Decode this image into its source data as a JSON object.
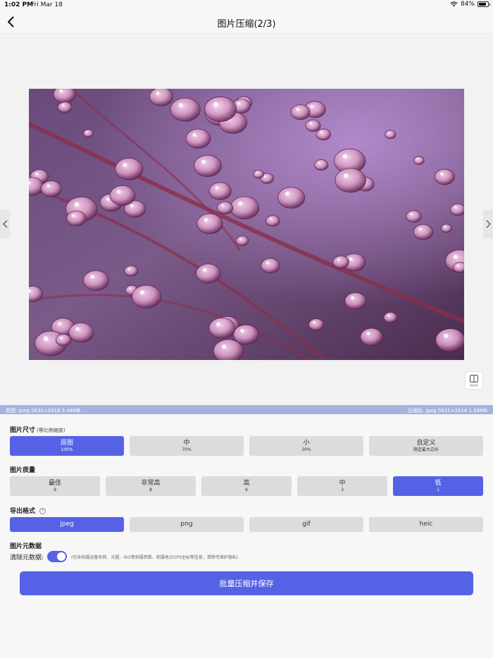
{
  "status_bar": {
    "time": "1:02 PM",
    "date": "Fri Mar 18",
    "battery": "84%",
    "battery_level": 0.84
  },
  "nav": {
    "title": "图片压缩(2/3)"
  },
  "preview": {
    "compare_label": "前后对比"
  },
  "info": {
    "original": "原图:  jpeg 5631×3518  5.44MB",
    "compressed": "压缩后:  jpeg 5631×3518  1.58MB"
  },
  "size": {
    "title": "图片尺寸",
    "subtitle": "(等比例缩放)",
    "options": [
      {
        "label": "原图",
        "sub": "100%"
      },
      {
        "label": "中",
        "sub": "70%"
      },
      {
        "label": "小",
        "sub": "30%"
      },
      {
        "label": "自定义",
        "sub": "限定最大边长"
      }
    ],
    "selected": 0
  },
  "quality": {
    "title": "图片质量",
    "options": [
      {
        "label": "最佳",
        "sub": "9"
      },
      {
        "label": "非常高",
        "sub": "8"
      },
      {
        "label": "高",
        "sub": "6"
      },
      {
        "label": "中",
        "sub": "3"
      },
      {
        "label": "低",
        "sub": "1"
      }
    ],
    "selected": 4
  },
  "format": {
    "title": "导出格式",
    "help": "?",
    "options": [
      "jpeg",
      "png",
      "gif",
      "heic"
    ],
    "selected": 0
  },
  "metadata": {
    "title": "图片元数据",
    "clear_label": "清除元数据:",
    "clear_on": true,
    "description": "(包含拍摄设备名称、光圈、ISO等拍摄参数、拍摄地点GPS坐标等信息，清除可保护隐私)"
  },
  "action": {
    "label": "批量压缩并保存"
  },
  "colors": {
    "accent": "#5662e6",
    "info_bar": "#a6b2de",
    "option_bg": "#dcdcdc"
  }
}
